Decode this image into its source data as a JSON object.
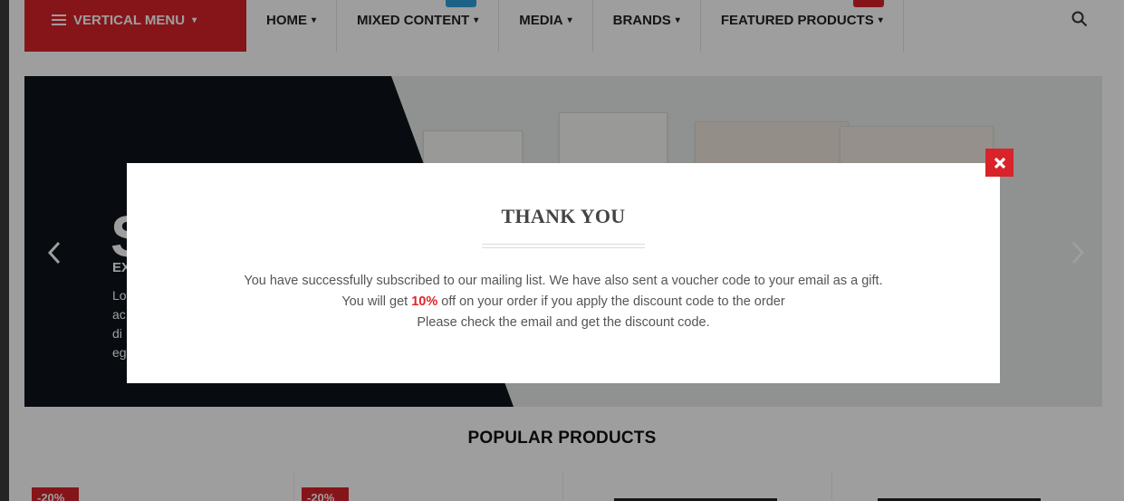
{
  "nav": {
    "vertical_menu": "VERTICAL MENU",
    "items": [
      {
        "label": "HOME"
      },
      {
        "label": "MIXED CONTENT"
      },
      {
        "label": "MEDIA"
      },
      {
        "label": "BRANDS"
      },
      {
        "label": "FEATURED PRODUCTS"
      }
    ]
  },
  "banner": {
    "big_letter": "S",
    "sub": "EX",
    "body": "Lo\nac\ndi\neg"
  },
  "popular": {
    "title": "POPULAR PRODUCTS",
    "sale_badges": [
      "-20%",
      "-20%"
    ]
  },
  "modal": {
    "title": "THANK YOU",
    "line1": "You have successfully subscribed to our mailing list. We have also sent a voucher code to your email as a gift.",
    "line2_before": "You will get ",
    "line2_highlight": "10%",
    "line2_after": " off on your order if you apply the discount code to the order",
    "line3": "Please check the email and get the discount code."
  },
  "colors": {
    "accent": "#d8232a",
    "mixed_badge": "#2f9fd8",
    "featured_badge": "#d8232a"
  },
  "icons": {
    "menu": "hamburger-icon",
    "search": "search-icon",
    "close": "close-icon",
    "prev": "chevron-left-icon",
    "next": "chevron-right-icon"
  }
}
